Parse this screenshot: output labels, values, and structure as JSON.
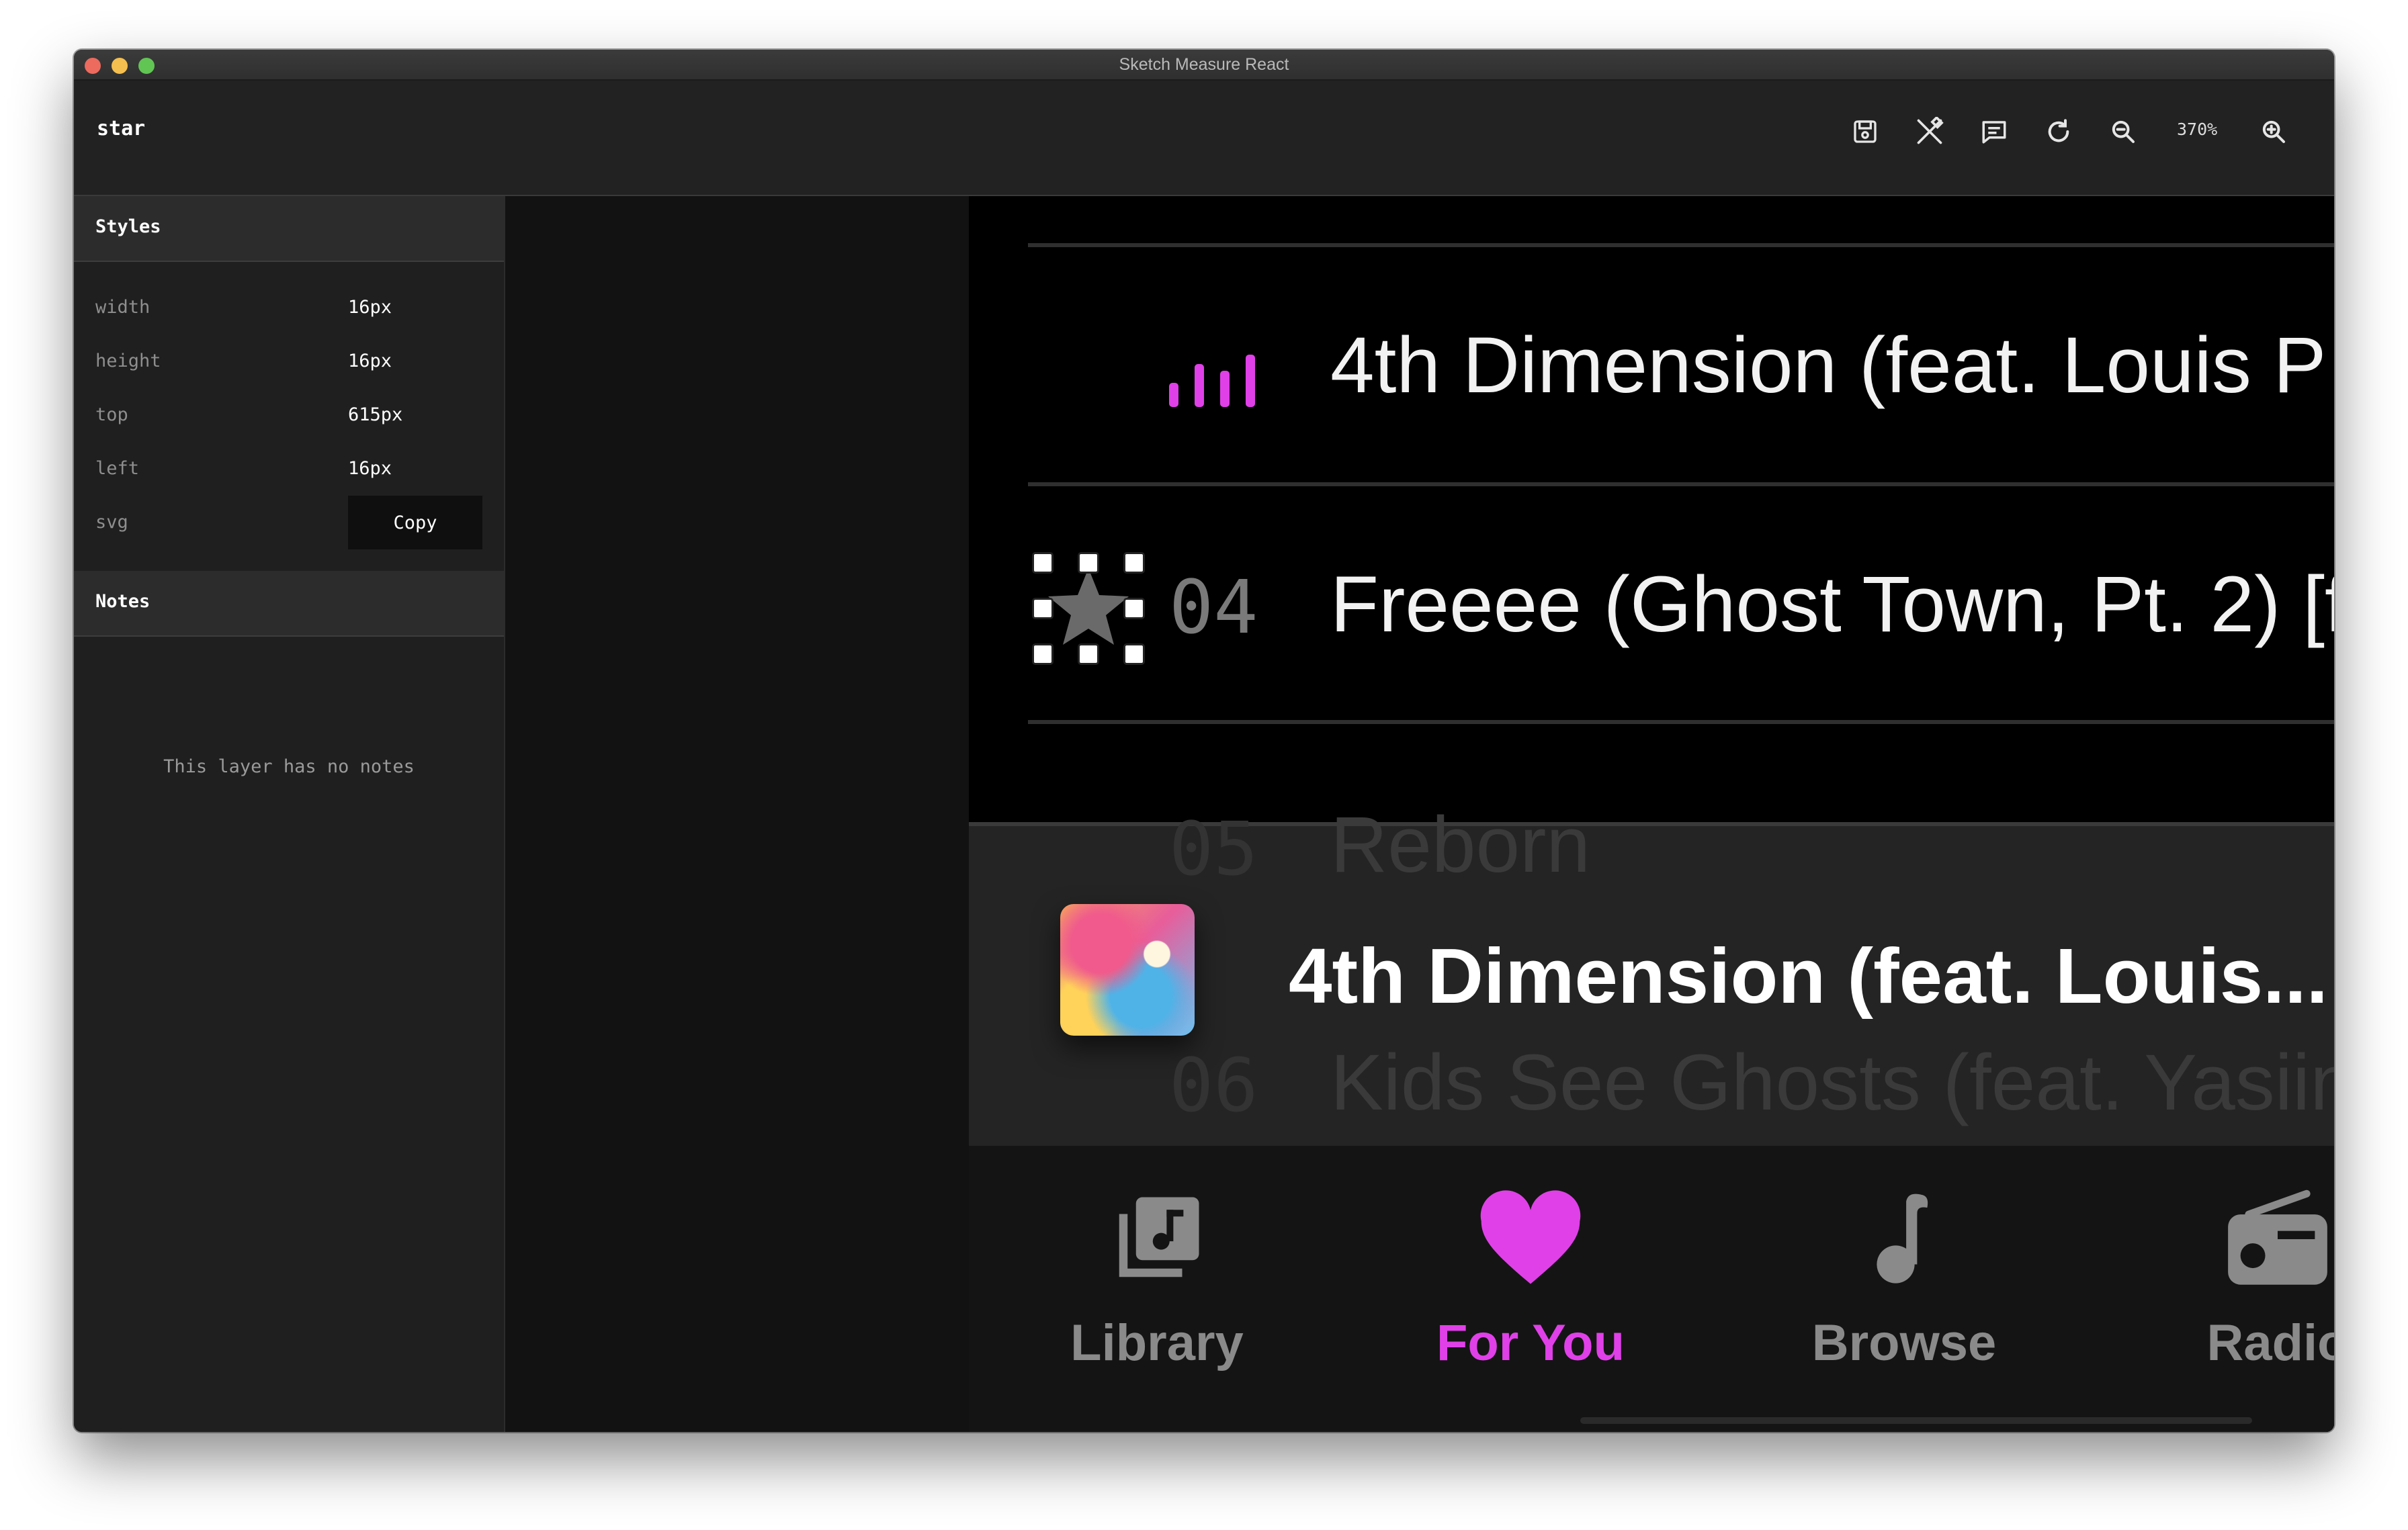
{
  "window": {
    "title": "Sketch Measure React"
  },
  "toolbar": {
    "layer_name": "star",
    "zoom_label": "370%",
    "icons": [
      "save-icon",
      "tools-icon",
      "comment-icon",
      "refresh-icon",
      "zoom-out-icon",
      "zoom-in-icon"
    ]
  },
  "sidebar": {
    "styles_title": "Styles",
    "props": [
      {
        "label": "width",
        "value": "16px"
      },
      {
        "label": "height",
        "value": "16px"
      },
      {
        "label": "top",
        "value": "615px"
      },
      {
        "label": "left",
        "value": "16px"
      },
      {
        "label": "svg",
        "value": ""
      }
    ],
    "copy_label": "Copy",
    "notes_title": "Notes",
    "notes_empty": "This layer has no notes"
  },
  "artboard": {
    "tracks": [
      {
        "number": "",
        "title": "4th Dimension (feat. Louis P"
      },
      {
        "number": "04",
        "title": "Freeee (Ghost Town, Pt. 2) [f"
      },
      {
        "number": "05",
        "title": "Reborn"
      },
      {
        "number": "06",
        "title": "Kids See Ghosts (feat. Yasiin"
      }
    ],
    "now_playing": "4th Dimension (feat. Louis...",
    "tabs": [
      {
        "label": "Library",
        "icon": "library-icon"
      },
      {
        "label": "For You",
        "icon": "heart-icon"
      },
      {
        "label": "Browse",
        "icon": "music-note-icon"
      },
      {
        "label": "Radio",
        "icon": "radio-icon"
      }
    ],
    "colors": {
      "accent": "#e040e8",
      "inactive": "#8a8a8a"
    }
  }
}
